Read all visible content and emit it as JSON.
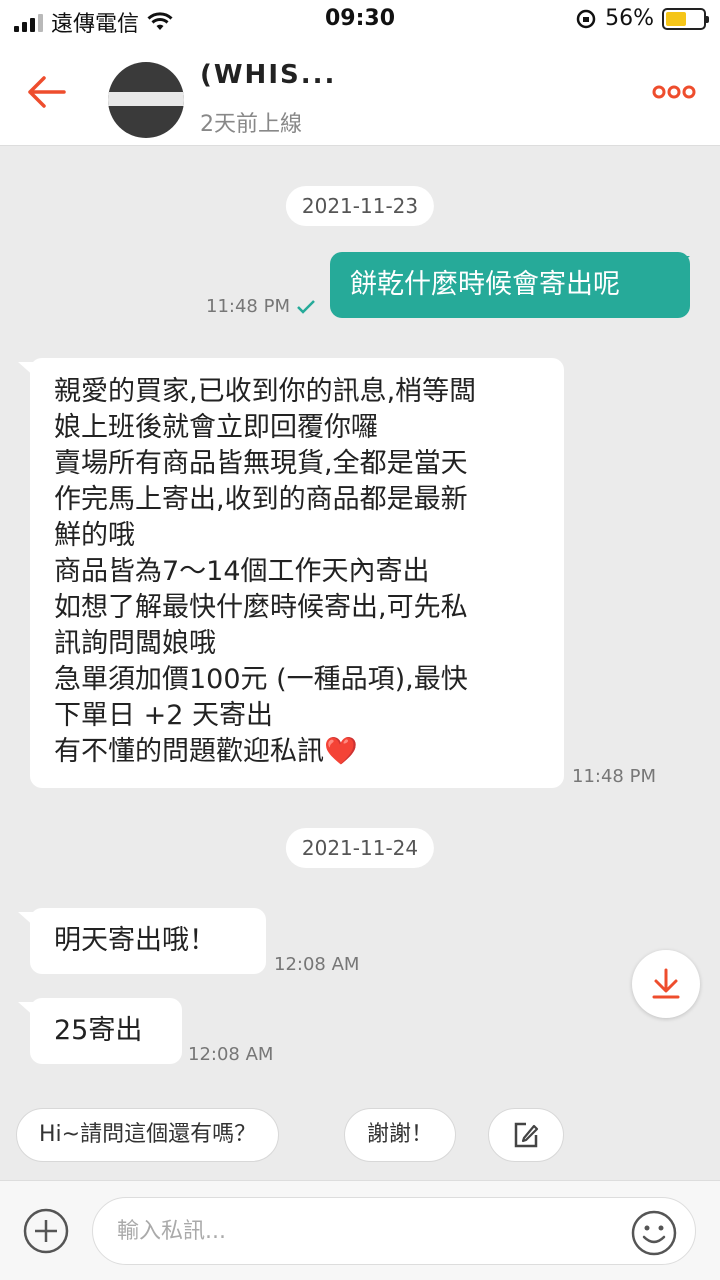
{
  "status_bar": {
    "carrier": "遠傳電信",
    "time": "09:30",
    "battery": "56%",
    "battery_level": 0.56
  },
  "header": {
    "shop_name": "(WHIS...",
    "last_seen": "2天前上線"
  },
  "chat": {
    "date_1": "2021-11-23",
    "msg_out_text": "餅乾什麼時候會寄出呢",
    "msg_out_time": "11:48 PM",
    "msg_in_1_lines": [
      "親愛的買家,已收到你的訊息,梢等闆",
      "娘上班後就會立即回覆你囉",
      "賣場所有商品皆無現貨,全都是當天",
      "作完馬上寄出,收到的商品都是最新",
      "鮮的哦",
      "商品皆為7～14個工作天內寄出",
      "如想了解最快什麼時候寄出,可先私",
      "訊詢問闆娘哦",
      "急單須加價100元 (一種品項),最快",
      "下單日 +2 天寄出",
      "有不懂的問題歡迎私訊❤️"
    ],
    "msg_in_1_time": "11:48 PM",
    "date_2": "2021-11-24",
    "msg_in_2_text": "明天寄出哦！",
    "msg_in_2_time": "12:08 AM",
    "msg_in_3_text": "25寄出",
    "msg_in_3_time": "12:08 AM"
  },
  "quick_replies": [
    "Hi~請問這個還有嗎？",
    "謝謝！"
  ],
  "input": {
    "placeholder": "輸入私訊..."
  },
  "colors": {
    "accent": "#ee4d2d",
    "outgoing_bubble": "#26aa99",
    "background": "#ebebeb"
  },
  "icons": [
    "back-arrow-icon",
    "more-dots-icon",
    "check-icon",
    "scroll-down-icon",
    "edit-icon",
    "plus-icon",
    "emoji-icon",
    "wifi-icon",
    "orientation-lock-icon"
  ]
}
